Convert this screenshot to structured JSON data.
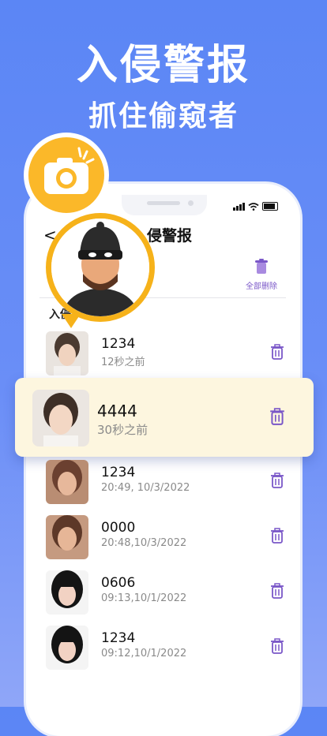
{
  "promo": {
    "title": "入侵警报",
    "subtitle": "抓住偷窥者"
  },
  "app": {
    "back_glyph": "<",
    "title": "侵警报",
    "delete_all_label": "全部删除",
    "section_label": "入侵"
  },
  "entries": [
    {
      "code": "1234",
      "time": "12秒之前"
    },
    {
      "code": "4444",
      "time": "30秒之前",
      "highlighted": true
    },
    {
      "code": "1234",
      "time": "20:49, 10/3/2022"
    },
    {
      "code": "0000",
      "time": "20:48,10/3/2022"
    },
    {
      "code": "0606",
      "time": "09:13,10/1/2022"
    },
    {
      "code": "1234",
      "time": "09:12,10/1/2022"
    }
  ],
  "icons": {
    "camera": "camera-icon",
    "thief": "thief-avatar-icon",
    "trash": "trash-icon",
    "back": "back-arrow-icon"
  },
  "colors": {
    "background": "#5b86f5",
    "accent_purple": "#7a57c8",
    "badge_yellow": "#fbb829",
    "highlight_bg": "#fdf6df"
  }
}
